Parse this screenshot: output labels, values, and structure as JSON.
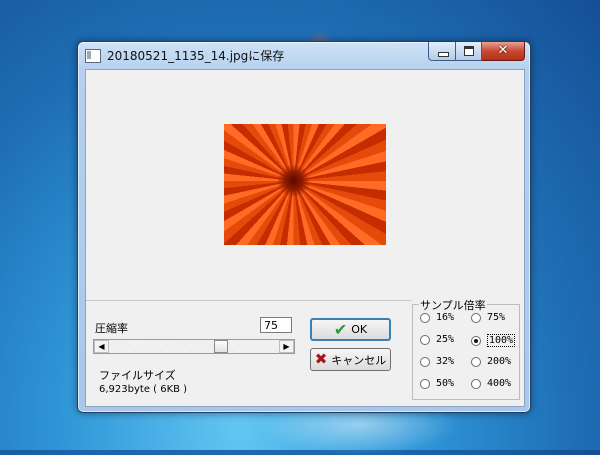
{
  "window": {
    "title": "20180521_1135_14.jpgに保存",
    "close_glyph": "✕"
  },
  "compression": {
    "label": "圧縮率",
    "value": "75",
    "slider_level_percent": 75
  },
  "buttons": {
    "ok_label": "OK",
    "cancel_label": "キャンセル"
  },
  "file_size": {
    "label": "ファイルサイズ",
    "value": "6,923byte ( 6KB )"
  },
  "sample_rate": {
    "title": "サンプル倍率",
    "options": [
      {
        "label": "16%",
        "selected": false
      },
      {
        "label": "75%",
        "selected": false
      },
      {
        "label": "25%",
        "selected": false
      },
      {
        "label": "100%",
        "selected": true
      },
      {
        "label": "32%",
        "selected": false
      },
      {
        "label": "200%",
        "selected": false
      },
      {
        "label": "50%",
        "selected": false
      },
      {
        "label": "400%",
        "selected": false
      }
    ]
  },
  "colors": {
    "ok_border": "#3c7fb1",
    "check_green": "#2c9a2c",
    "cancel_red": "#a81515",
    "close_button": "#c74a32"
  },
  "icons": [
    "app-window-icon",
    "minimize-icon",
    "maximize-icon",
    "close-icon",
    "check-icon",
    "x-icon",
    "scroll-left-icon",
    "scroll-right-icon"
  ]
}
